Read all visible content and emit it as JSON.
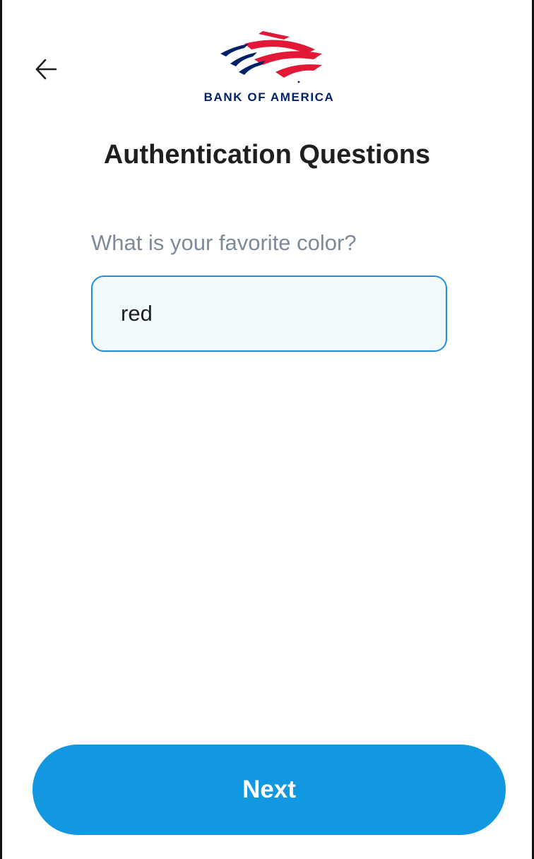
{
  "header": {
    "back_icon": "arrow-left-icon",
    "logo": {
      "text": "BANK OF AMERICA",
      "colors": {
        "red": "#E31837",
        "blue": "#012169"
      }
    }
  },
  "main": {
    "title": "Authentication Questions",
    "question": "What is your favorite color?",
    "answer_value": "red",
    "field_border_color": "#1F8FD6"
  },
  "footer": {
    "next_label": "Next",
    "button_color": "#1198E0"
  }
}
